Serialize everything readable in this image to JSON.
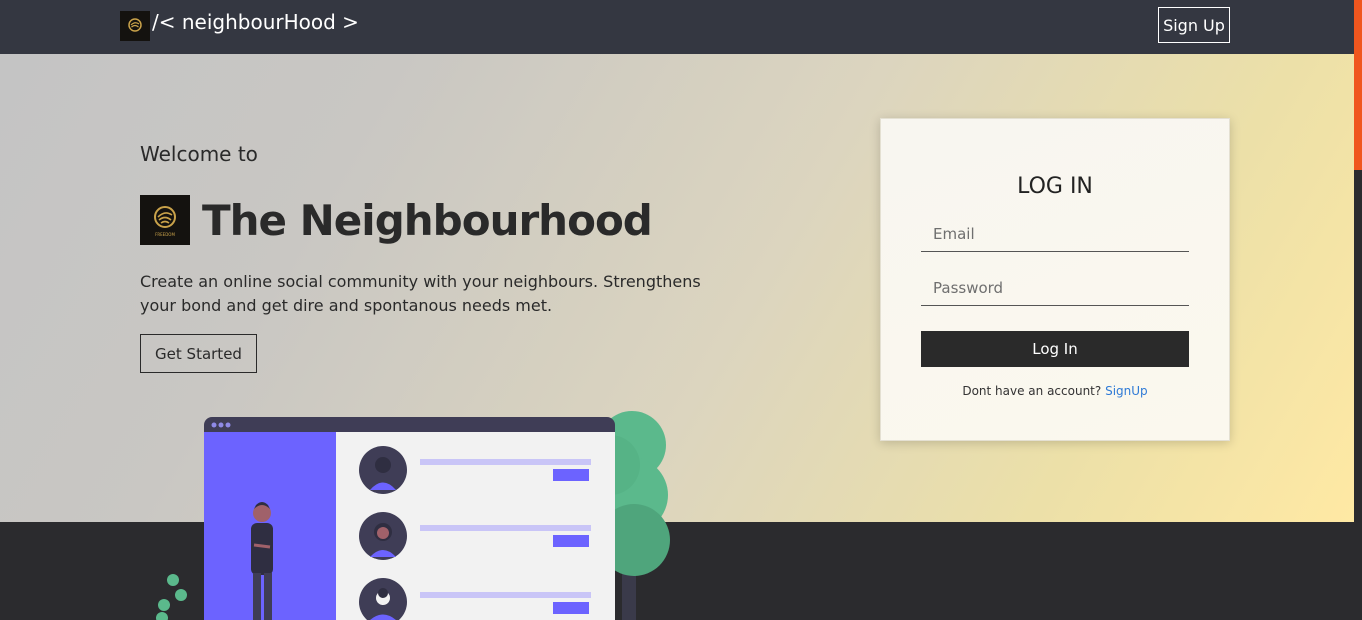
{
  "header": {
    "brand_text": "/< neighbourHood >",
    "signup_label": "Sign Up"
  },
  "hero": {
    "welcome": "Welcome to",
    "title": "The Neighbourhood",
    "description": "Create an online social community with your neighbours. Strengthens your bond and get dire and spontanous needs met.",
    "cta_label": "Get Started",
    "logo_caption": "FREEDOM"
  },
  "login": {
    "title": "LOG IN",
    "email_placeholder": "Email",
    "password_placeholder": "Password",
    "button_label": "Log In",
    "no_account_text": "Dont have an account?",
    "signup_link": "SignUp"
  },
  "colors": {
    "header_bg": "#343741",
    "dark_bg": "#2b2b2e",
    "accent_purple": "#6c63ff",
    "accent_green": "#5bb98c",
    "link_blue": "#2f7bd6",
    "scrollbar_thumb": "#f0561e"
  },
  "icons": {
    "brand_logo": "brand-logo-icon"
  }
}
